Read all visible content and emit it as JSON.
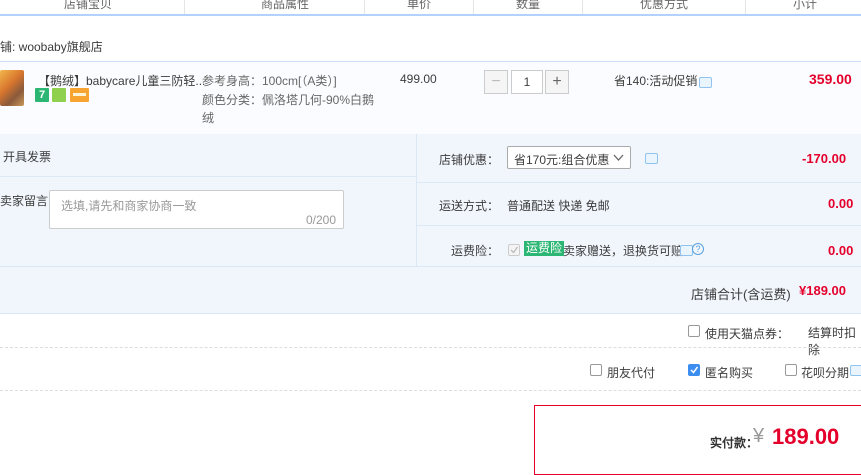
{
  "header": {
    "columns": [
      "店铺宝贝",
      "商品属性",
      "单价",
      "数量",
      "优惠方式",
      "小计"
    ]
  },
  "shop": {
    "name": "铺: woobaby旗舰店"
  },
  "item": {
    "title": "【鹅绒】babycare儿童三防轻...",
    "attr_height": "参考身高：100cm[（A类）]",
    "attr_color_line1": "颜色分类：佩洛塔几何-90%白鹅",
    "attr_color_line2": "绒",
    "price": "499.00",
    "quantity": "1",
    "minus": "−",
    "plus": "+",
    "discount": "省140:活动促销",
    "subtotal": "359.00"
  },
  "invoice": {
    "label": "开具发票"
  },
  "message": {
    "label": "卖家留言：",
    "placeholder": "选填,请先和商家协商一致",
    "counter": "0/200"
  },
  "shop_discount": {
    "label": "店铺优惠：",
    "selected": "省170元:组合优惠",
    "amount": "-170.00"
  },
  "shipping": {
    "label": "运送方式：",
    "value": "普通配送 快递 免邮",
    "amount": "0.00"
  },
  "insurance": {
    "label": "运费险：",
    "badge": "运费险",
    "text": "卖家赠送，退换货可赔",
    "help": "?",
    "amount": "0.00"
  },
  "shop_total": {
    "label": "店铺合计(含运费)",
    "amount": "¥189.00"
  },
  "coupon": {
    "label": "使用天猫点券：",
    "note": "结算时扣除"
  },
  "options": {
    "friend_pay": "朋友代付",
    "anonymous": "匿名购买",
    "huabei": "花呗分期"
  },
  "payment": {
    "label": "实付款：",
    "currency": "¥",
    "amount": "189.00"
  },
  "colors": {
    "accent_red": "#e4002b",
    "header_line": "#b2d1ff",
    "panel_bg": "#f1f6fd"
  }
}
